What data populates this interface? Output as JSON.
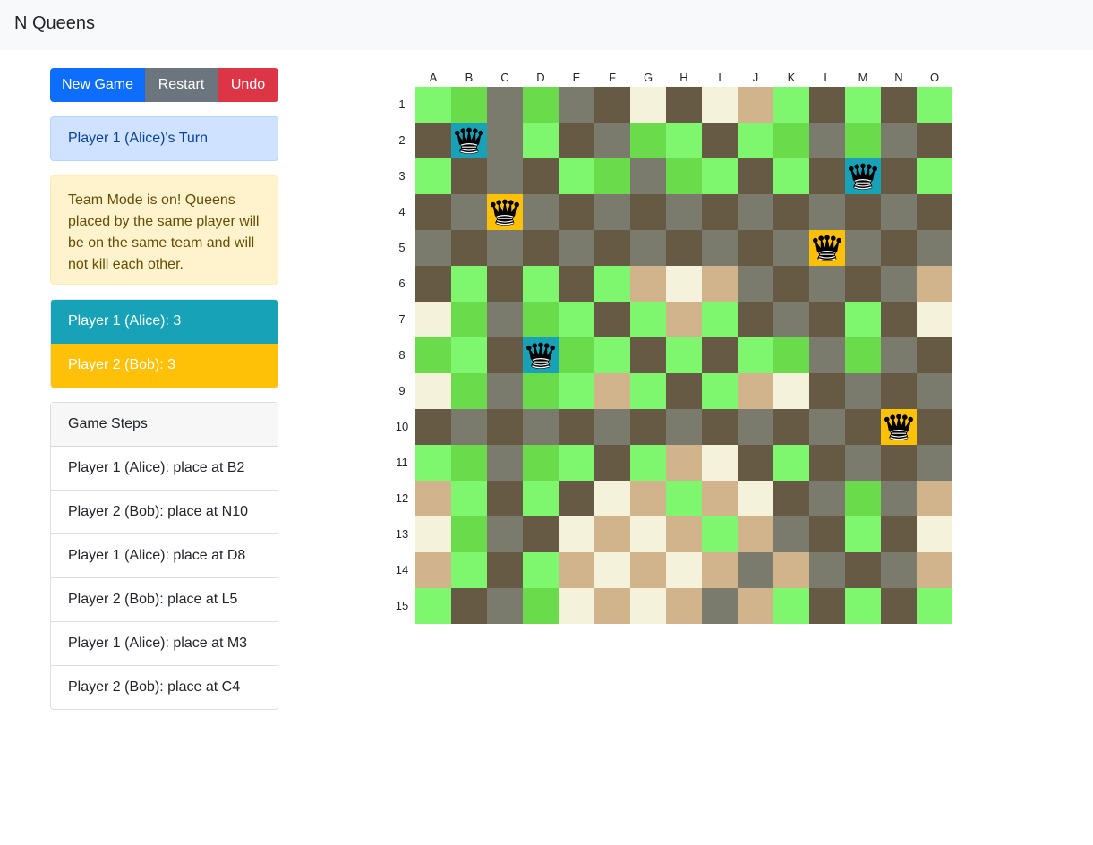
{
  "navbar": {
    "title": "N Queens"
  },
  "buttons": {
    "new_game": "New Game",
    "restart": "Restart",
    "undo": "Undo"
  },
  "turn": "Player 1 (Alice)'s Turn",
  "team_mode_notice": "Team Mode is on! Queens placed by the same player will be on the same team and will not kill each other.",
  "scores": [
    {
      "label": "Player 1 (Alice): 3",
      "color": "#17a2b8"
    },
    {
      "label": "Player 2 (Bob): 3",
      "color": "#ffc107"
    }
  ],
  "steps": {
    "header": "Game Steps",
    "items": [
      "Player 1 (Alice): place at B2",
      "Player 2 (Bob): place at N10",
      "Player 1 (Alice): place at D8",
      "Player 2 (Bob): place at L5",
      "Player 1 (Alice): place at M3",
      "Player 2 (Bob): place at C4"
    ]
  },
  "board": {
    "columns": [
      "A",
      "B",
      "C",
      "D",
      "E",
      "F",
      "G",
      "H",
      "I",
      "J",
      "K",
      "L",
      "M",
      "N",
      "O"
    ],
    "rows": [
      "1",
      "2",
      "3",
      "4",
      "5",
      "6",
      "7",
      "8",
      "9",
      "10",
      "11",
      "12",
      "13",
      "14",
      "15"
    ],
    "colors": {
      "G": "#7ef76f",
      "g": "#6adc4c",
      "D": "#675a45",
      "S": "#7b7b6d",
      "C": "#f5f2dc",
      "T": "#d2b48c",
      "P1": "#17a2b8",
      "P2": "#ffc107"
    },
    "grid": [
      "GgSgSDCDCTGDGDG",
      "DASGDSgGDGgSgSD",
      "GDSDGgSgGDGDADG",
      "DSBSDSDSDSDSDSD",
      "SDSDSDSDSDSBSDS",
      "DGDGDGTCTSDSDST",
      "CgSgGDGTGDSDGDC",
      "gGDAgGDGDGgSgSD",
      "CgSgGTGDGTCDSDS",
      "DSDSDSDSDSDSDBD",
      "GgSgGDGTCDGDSDS",
      "TGDGDCTGTCDSgST",
      "CgSDCTCTGTSDGDC",
      "TGDGTCTCTSTSDST",
      "GDSgCTCTSTGDGDG"
    ],
    "queen_icon": "queen-icon"
  }
}
